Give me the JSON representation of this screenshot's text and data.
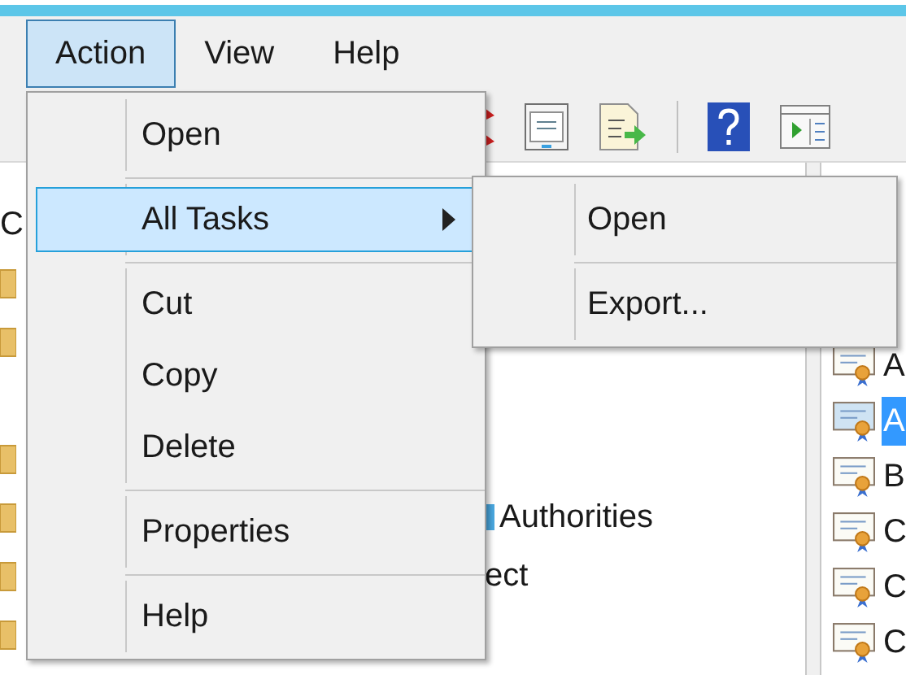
{
  "menubar": [
    {
      "label": "Action",
      "selected": true
    },
    {
      "label": "View",
      "selected": false
    },
    {
      "label": "Help",
      "selected": false
    }
  ],
  "left_pane": {
    "fragment": "C"
  },
  "middle_pane": {
    "rows": [
      "Authorities",
      "ect"
    ]
  },
  "right_pane": {
    "items": [
      {
        "label": "A",
        "selected": false
      },
      {
        "label": "A",
        "selected": true
      },
      {
        "label": "B",
        "selected": false
      },
      {
        "label": "C",
        "selected": false
      },
      {
        "label": "C",
        "selected": false
      },
      {
        "label": "C",
        "selected": false
      }
    ]
  },
  "action_menu": {
    "items": [
      {
        "kind": "item",
        "label": "Open",
        "selected": false
      },
      {
        "kind": "separator"
      },
      {
        "kind": "submenu",
        "label": "All Tasks",
        "selected": true
      },
      {
        "kind": "separator"
      },
      {
        "kind": "item",
        "label": "Cut",
        "selected": false
      },
      {
        "kind": "item",
        "label": "Copy",
        "selected": false
      },
      {
        "kind": "item",
        "label": "Delete",
        "selected": false
      },
      {
        "kind": "separator"
      },
      {
        "kind": "item",
        "label": "Properties",
        "selected": false
      },
      {
        "kind": "separator"
      },
      {
        "kind": "item",
        "label": "Help",
        "selected": false
      }
    ]
  },
  "submenu": {
    "items": [
      {
        "kind": "item",
        "label": "Open",
        "selected": false
      },
      {
        "kind": "separator"
      },
      {
        "kind": "item",
        "label": "Export...",
        "selected": false
      }
    ]
  }
}
